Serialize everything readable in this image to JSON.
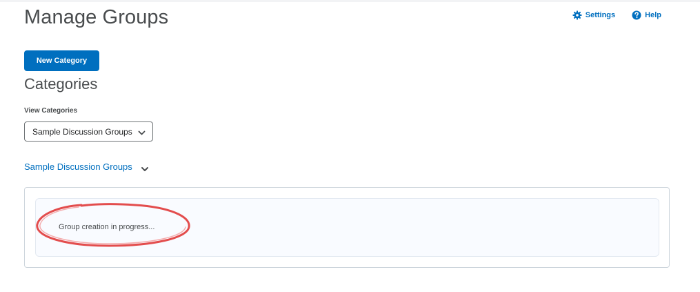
{
  "header": {
    "title": "Manage Groups",
    "settings_label": "Settings",
    "help_label": "Help"
  },
  "toolbar": {
    "new_category_label": "New Category"
  },
  "categories": {
    "title": "Categories",
    "view_label": "View Categories",
    "selected": "Sample Discussion Groups"
  },
  "group": {
    "name": "Sample Discussion Groups",
    "status_text": "Group creation in progress..."
  },
  "icons": {
    "settings": "gear-icon",
    "help": "help-icon",
    "select_chevron": "chevron-down-icon",
    "group_chevron": "chevron-down-icon"
  },
  "colors": {
    "accent": "#006fbf",
    "annotation": "#e03a3a",
    "text": "#494c4e"
  }
}
